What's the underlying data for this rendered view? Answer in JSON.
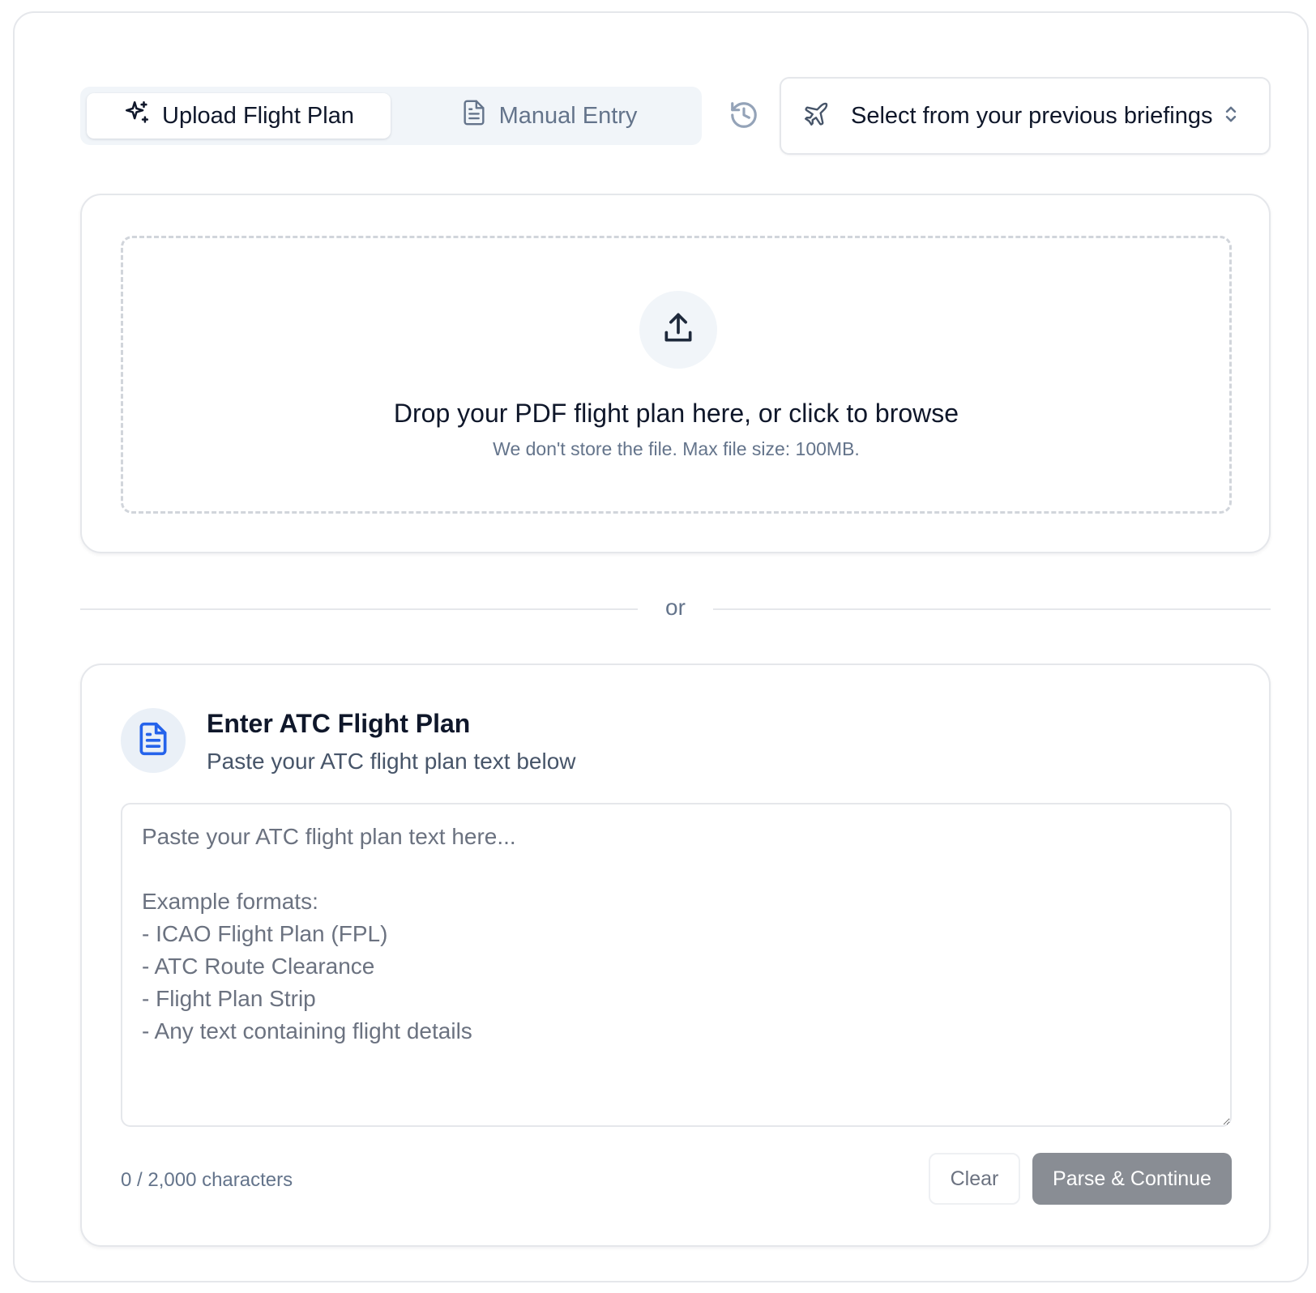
{
  "tabs": {
    "upload_label": "Upload Flight Plan",
    "manual_label": "Manual Entry",
    "active": "upload"
  },
  "briefings_select": {
    "placeholder": "Select from your previous briefings"
  },
  "upload": {
    "title": "Drop your PDF flight plan here, or click to browse",
    "subtitle": "We don't store the file. Max file size: 100MB."
  },
  "divider_text": "or",
  "manual": {
    "title": "Enter ATC Flight Plan",
    "subtitle": "Paste your ATC flight plan text below",
    "textarea_value": "",
    "textarea_placeholder": "Paste your ATC flight plan text here...\n\nExample formats:\n- ICAO Flight Plan (FPL)\n- ATC Route Clearance\n- Flight Plan Strip\n- Any text containing flight details",
    "char_count": "0 / 2,000 characters",
    "clear_label": "Clear",
    "parse_label": "Parse & Continue"
  },
  "colors": {
    "accent_blue": "#2563eb",
    "parse_button_disabled": "#898d94",
    "muted_text": "#64748b"
  }
}
